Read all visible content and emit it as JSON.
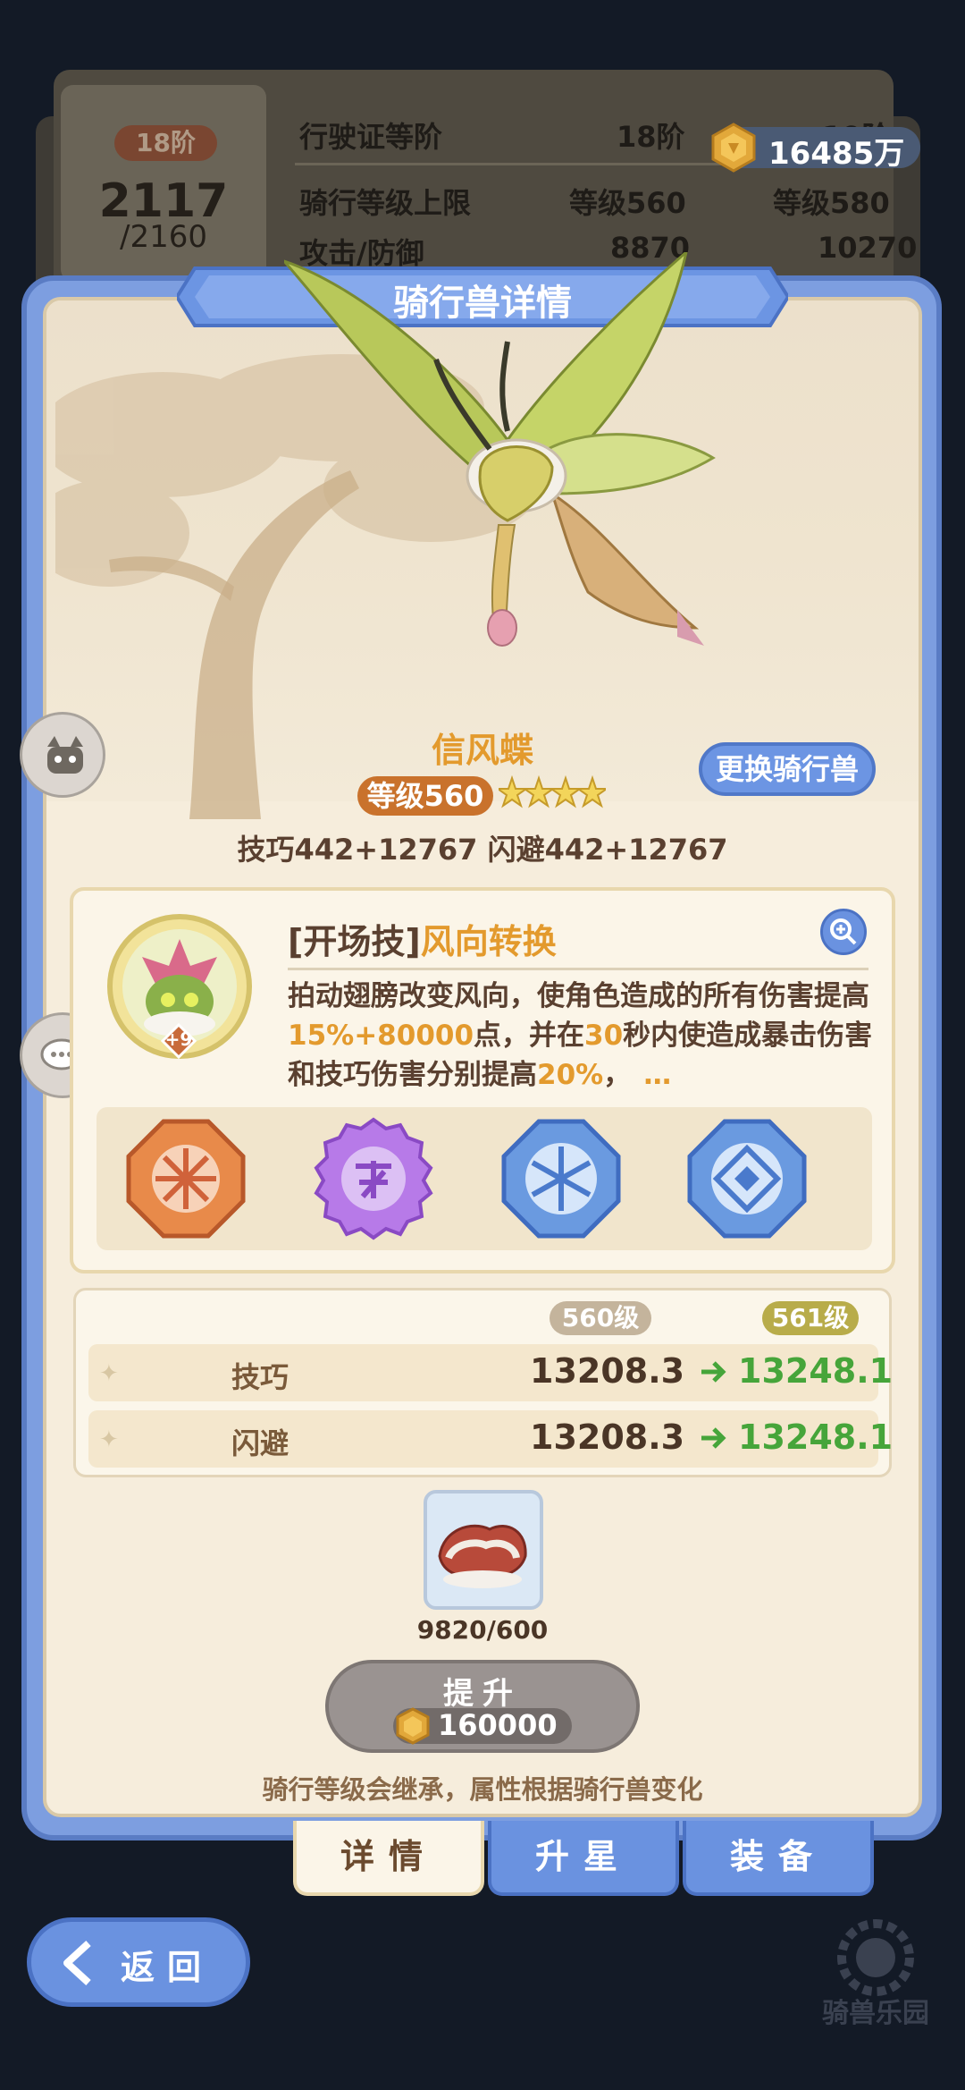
{
  "currency": {
    "amount": "16485万",
    "icon": "coin-icon"
  },
  "license": {
    "rank_badge": "18阶",
    "points": "2117",
    "points_max": "/2160",
    "rows": [
      {
        "label": "行驶证等阶",
        "current": "18阶",
        "next": "19阶"
      },
      {
        "label": "骑行等级上限",
        "current": "等级560",
        "next": "等级580"
      },
      {
        "label": "攻击/防御",
        "current": "8870",
        "next": "10270"
      }
    ]
  },
  "panel": {
    "title": "骑行兽详情"
  },
  "pet": {
    "name": "信风蝶",
    "level": "等级560",
    "stars": 4,
    "stats": "技巧442+12767  闪避442+12767",
    "change_button": "更换骑行兽"
  },
  "skill": {
    "tag": "[开场技]",
    "name": "风向转换",
    "badge": "+9",
    "desc_parts": [
      {
        "t": "拍动翅膀改变风向，使角色造成的所有伤害提高",
        "hl": false
      },
      {
        "t": "15%+80000",
        "hl": true
      },
      {
        "t": "点，并在",
        "hl": false
      },
      {
        "t": "30",
        "hl": true
      },
      {
        "t": "秒内使造成暴击伤害和技巧伤害分别提高",
        "hl": false
      },
      {
        "t": "20%",
        "hl": true
      },
      {
        "t": "，",
        "hl": false
      },
      {
        "t": "…",
        "hl": true
      }
    ],
    "runes": [
      "orange-rune-icon",
      "purple-rune-icon",
      "blue-snowflake-rune-icon",
      "blue-diamond-rune-icon"
    ]
  },
  "levels": {
    "current": "560级",
    "next": "561级"
  },
  "attributes": [
    {
      "name": "技巧",
      "current": "13208.3",
      "next": "13248.1"
    },
    {
      "name": "闪避",
      "current": "13208.3",
      "next": "13248.1"
    }
  ],
  "material": {
    "count": "9820/600",
    "icon": "saddle-item-icon"
  },
  "upgrade": {
    "label": "提升",
    "cost": "160000"
  },
  "note": "骑行等级会继承，属性根据骑行兽变化",
  "tabs": [
    {
      "label": "详情",
      "active": true
    },
    {
      "label": "升星",
      "active": false
    },
    {
      "label": "装备",
      "active": false
    }
  ],
  "back": {
    "label": "返回"
  },
  "logo": {
    "text": "骑兽乐园"
  }
}
